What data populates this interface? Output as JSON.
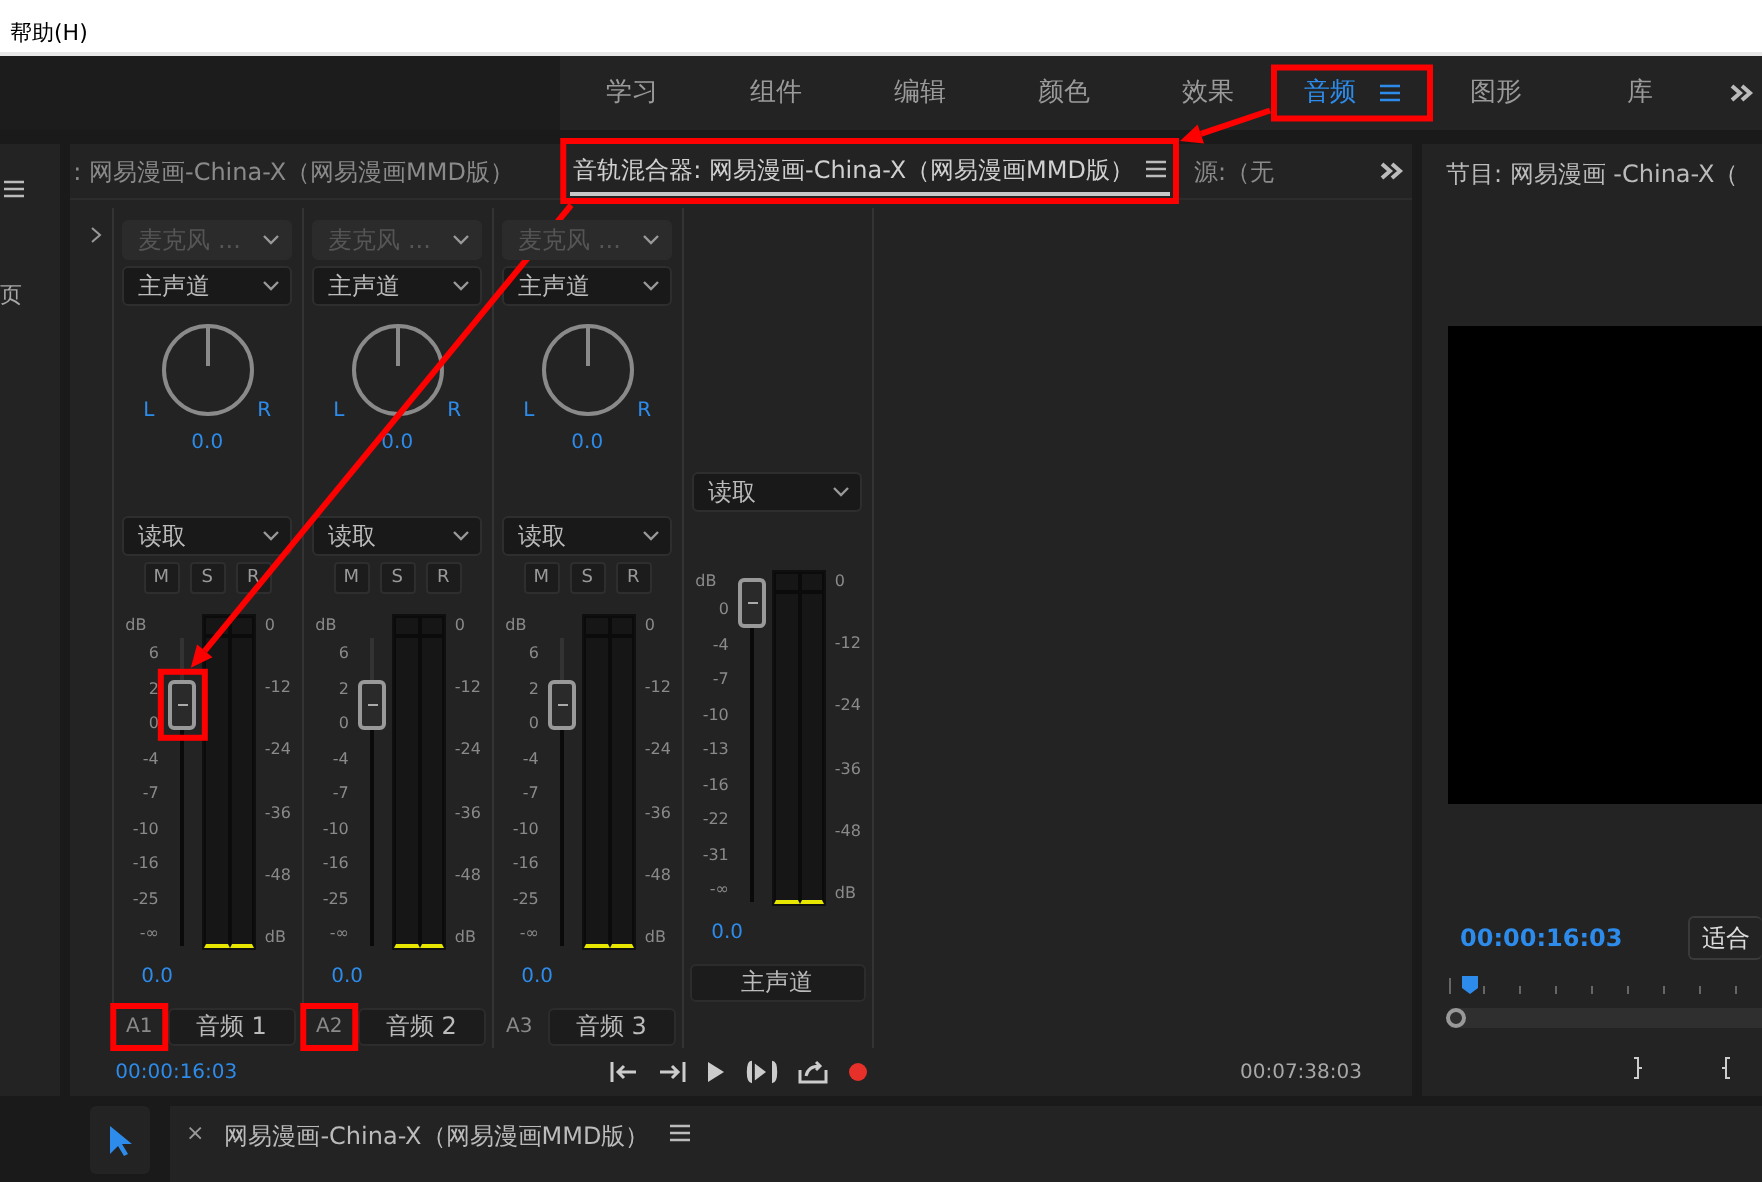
{
  "menu": {
    "label": "帮助(H)"
  },
  "workspaces": [
    {
      "label": "学习",
      "selected": false
    },
    {
      "label": "组件",
      "selected": false
    },
    {
      "label": "编辑",
      "selected": false
    },
    {
      "label": "颜色",
      "selected": false
    },
    {
      "label": "效果",
      "selected": false
    },
    {
      "label": "音频",
      "selected": true
    },
    {
      "label": "图形",
      "selected": false
    },
    {
      "label": "库",
      "selected": false
    }
  ],
  "left_panel": {
    "label": "页"
  },
  "mixer": {
    "tabs": [
      {
        "label": ": 网易漫画-China-X（网易漫画MMD版）",
        "selected": false
      },
      {
        "label": "音轨混合器: 网易漫画-China-X（网易漫画MMD版）",
        "selected": true
      },
      {
        "label": "源:（无",
        "selected": false
      }
    ],
    "channels": [
      {
        "kind": "track",
        "input": "麦克风 ...",
        "output": "主声道",
        "pan_l": "L",
        "pan_r": "R",
        "pan_value": "0.0",
        "automation": "读取",
        "buttons": [
          "M",
          "S",
          "R"
        ],
        "db_label": "dB",
        "fader_scale": [
          "6",
          "2",
          "0",
          "-4",
          "-7",
          "-10",
          "-16",
          "-25",
          "-∞"
        ],
        "level": 0.78,
        "meter_scale": [
          "0",
          "-12",
          "-24",
          "-36",
          "-48",
          "dB"
        ],
        "value": "0.0",
        "id": "A1",
        "name": "音频 1"
      },
      {
        "kind": "track",
        "input": "麦克风 ...",
        "output": "主声道",
        "pan_l": "L",
        "pan_r": "R",
        "pan_value": "0.0",
        "automation": "读取",
        "buttons": [
          "M",
          "S",
          "R"
        ],
        "db_label": "dB",
        "fader_scale": [
          "6",
          "2",
          "0",
          "-4",
          "-7",
          "-10",
          "-16",
          "-25",
          "-∞"
        ],
        "level": 0.78,
        "meter_scale": [
          "0",
          "-12",
          "-24",
          "-36",
          "-48",
          "dB"
        ],
        "value": "0.0",
        "id": "A2",
        "name": "音频 2"
      },
      {
        "kind": "track",
        "input": "麦克风 ...",
        "output": "主声道",
        "pan_l": "L",
        "pan_r": "R",
        "pan_value": "0.0",
        "automation": "读取",
        "buttons": [
          "M",
          "S",
          "R"
        ],
        "db_label": "dB",
        "fader_scale": [
          "6",
          "2",
          "0",
          "-4",
          "-7",
          "-10",
          "-16",
          "-25",
          "-∞"
        ],
        "level": 0.78,
        "meter_scale": [
          "0",
          "-12",
          "-24",
          "-36",
          "-48",
          "dB"
        ],
        "value": "0.0",
        "id": "A3",
        "name": "音频 3"
      },
      {
        "kind": "master",
        "automation": "读取",
        "db_label": "dB",
        "fader_scale": [
          "0",
          "-4",
          "-7",
          "-10",
          "-13",
          "-16",
          "-22",
          "-31",
          "-∞"
        ],
        "level": 0.97,
        "meter_scale": [
          "0",
          "-12",
          "-24",
          "-36",
          "-48",
          "dB"
        ],
        "value": "0.0",
        "name": "主声道"
      }
    ],
    "current_time": "00:00:16:03",
    "duration": "00:07:38:03"
  },
  "program": {
    "title": "节目: 网易漫画 -China-X（",
    "timecode": "00:00:16:03",
    "zoom": "适合"
  },
  "timeline": {
    "close": "×",
    "title": "网易漫画-China-X（网易漫画MMD版）"
  }
}
